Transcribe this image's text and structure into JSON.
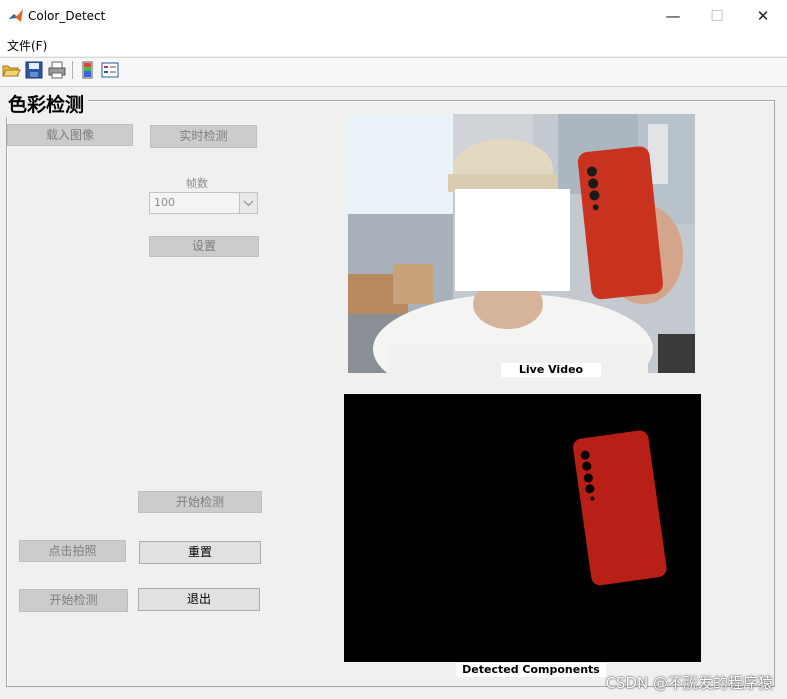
{
  "window": {
    "title": "Color_Detect",
    "controls": {
      "minimize": "—",
      "maximize": "☐",
      "close": "✕"
    }
  },
  "menu": {
    "file_label": "文件(F)"
  },
  "toolbar": {
    "icons": [
      "open-folder-icon",
      "save-icon",
      "print-icon",
      "colorbar-icon",
      "legend-icon"
    ]
  },
  "panel": {
    "title": "色彩检测"
  },
  "buttons": {
    "load_image": "载入图像",
    "realtime_detect": "实时检测",
    "settings": "设置",
    "start_detect_top": "开始检测",
    "capture": "点击拍照",
    "reset": "重置",
    "start_detect_bottom": "开始检测",
    "exit": "退出"
  },
  "frames": {
    "label": "帧数",
    "value": "100"
  },
  "axes": {
    "live_label": "Live Video",
    "detected_label": "Detected Components"
  },
  "watermark": "CSDN @不脱发的程序猿",
  "colors": {
    "phone_red": "#c8321f",
    "detected_red": "#b81f17",
    "button_disabled": "#cccccc",
    "button_enabled": "#e1e1e1"
  }
}
